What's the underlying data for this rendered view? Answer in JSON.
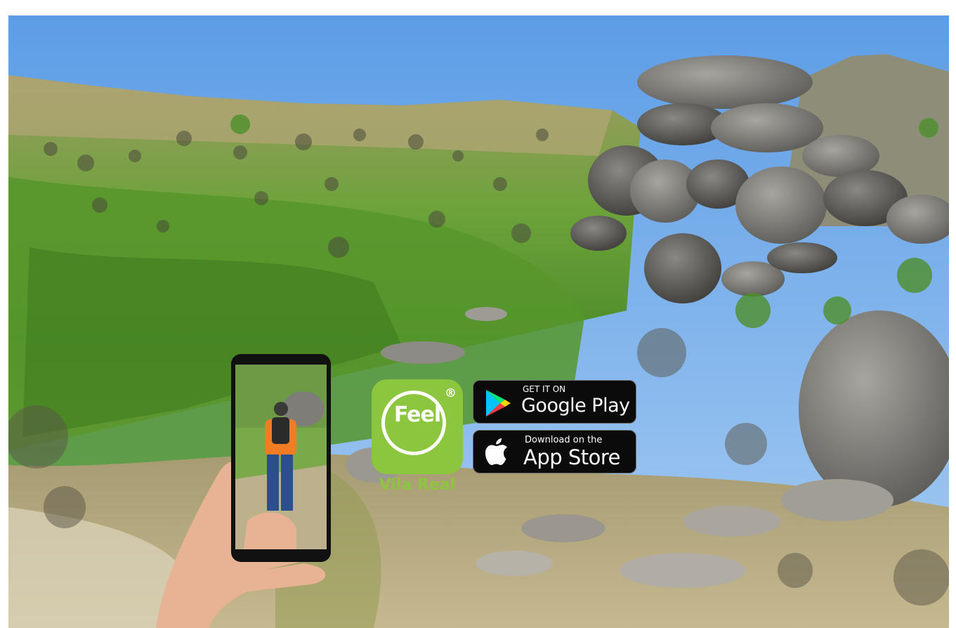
{
  "brand": {
    "logo_word": "Feel",
    "registered_mark": "®",
    "subtitle": "Vila Real",
    "logo_color": "#8cc63f"
  },
  "store_badges": {
    "google_play": {
      "top_line": "GET IT ON",
      "main_line": "Google Play",
      "icon": "google-play-icon"
    },
    "app_store": {
      "top_line": "Download on the",
      "main_line": "App Store",
      "icon": "apple-icon"
    }
  },
  "colors": {
    "sky": "#6fa8e8",
    "vegetation": "#5f9e2e",
    "rock": "#8d8b86",
    "badge_bg": "#0b0b0b"
  }
}
